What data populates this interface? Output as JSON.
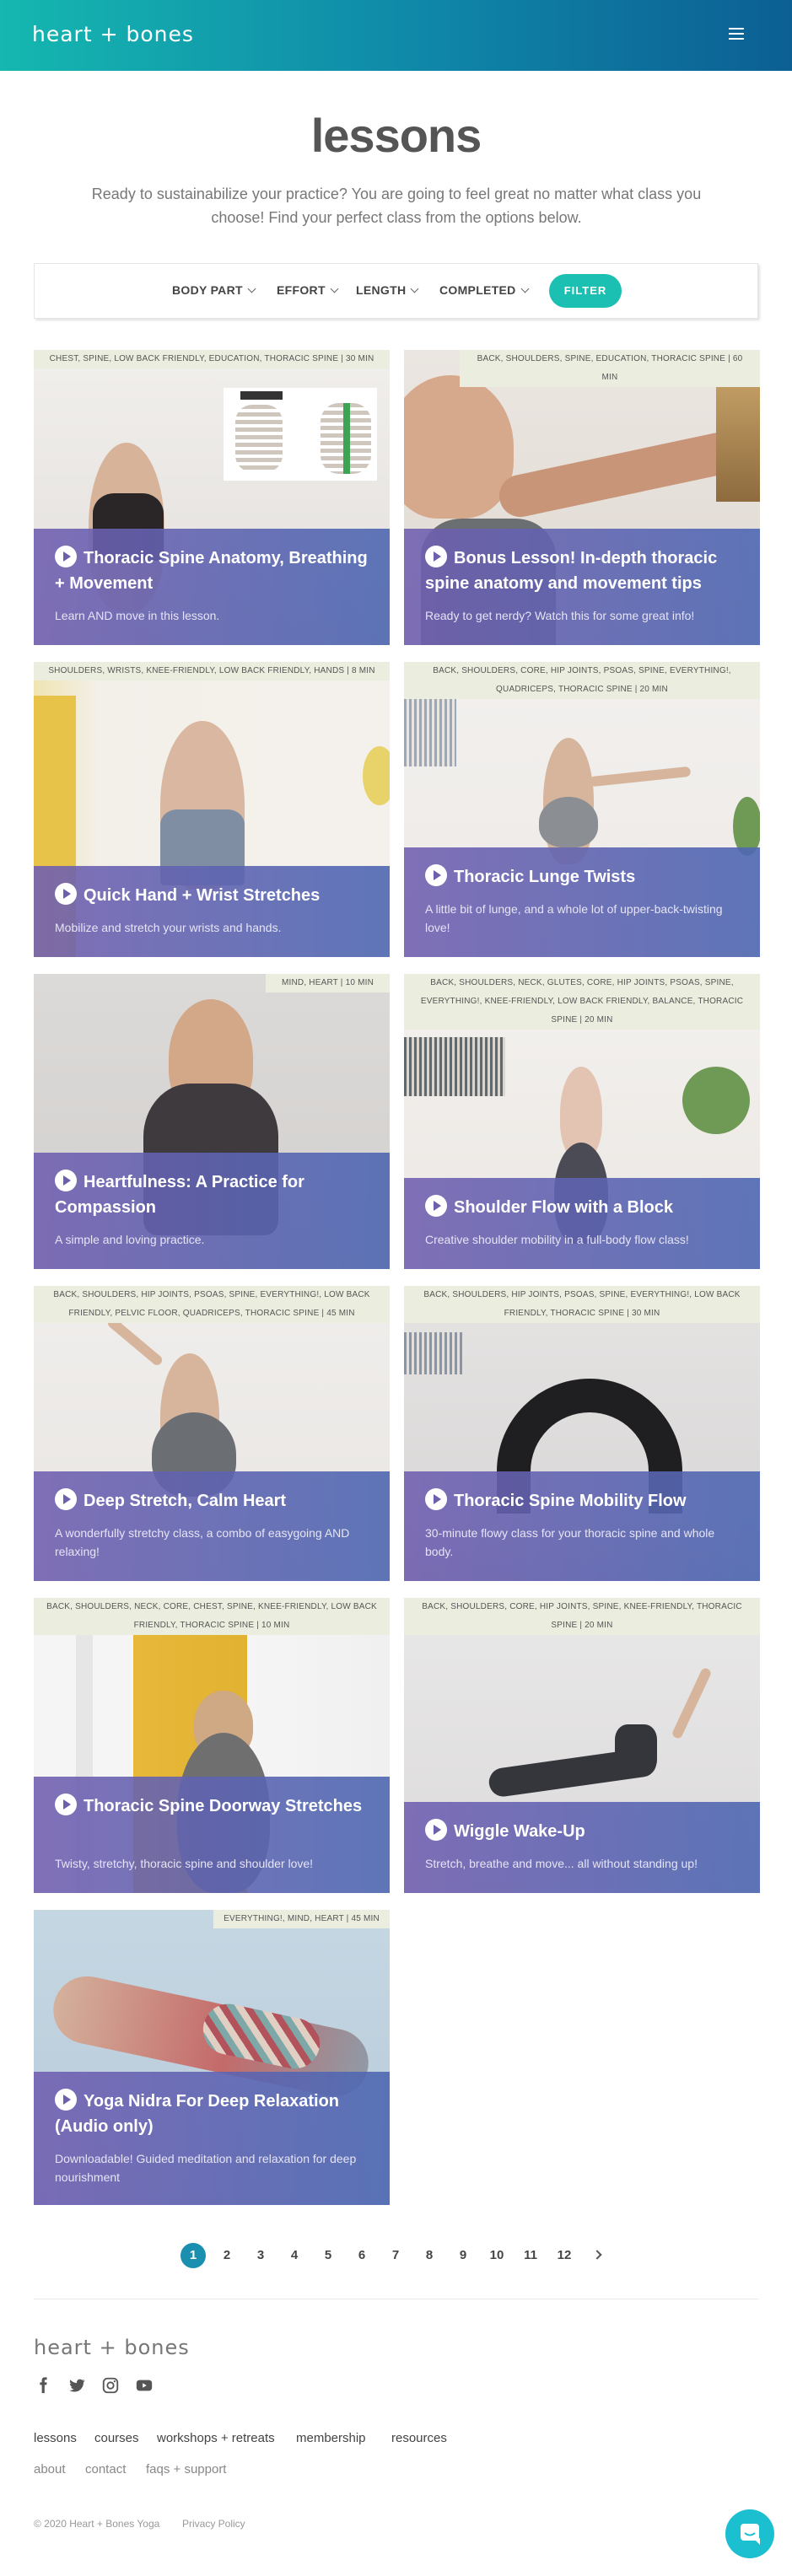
{
  "header": {
    "logo": "heart + bones",
    "menu_icon": "hamburger-menu-icon"
  },
  "hero": {
    "title": "lessons",
    "intro": "Ready to sustainabilize your practice? You are going to feel great no matter what class you choose! Find your perfect class from the options below."
  },
  "filters": {
    "items": [
      "BODY PART",
      "EFFORT",
      "LENGTH",
      "COMPLETED"
    ],
    "button": "FILTER"
  },
  "lessons": [
    {
      "tags": "CHEST, SPINE, LOW BACK FRIENDLY, EDUCATION, THORACIC SPINE | 30 MIN",
      "title": "Thoracic Spine Anatomy, Breathing + Movement",
      "description": "Learn AND move in this lesson."
    },
    {
      "tags": "BACK, SHOULDERS, SPINE, EDUCATION, THORACIC SPINE | 60 MIN",
      "title": "Bonus Lesson! In-depth thoracic spine anatomy and movement tips",
      "description": "Ready to get nerdy? Watch this for some great info!"
    },
    {
      "tags": "SHOULDERS, WRISTS, KNEE-FRIENDLY, LOW BACK FRIENDLY, HANDS | 8 MIN",
      "title": "Quick Hand + Wrist Stretches",
      "description": "Mobilize and stretch your wrists and hands."
    },
    {
      "tags": "BACK, SHOULDERS, CORE, HIP JOINTS, PSOAS, SPINE, EVERYTHING!, QUADRICEPS, THORACIC SPINE | 20 MIN",
      "title": "Thoracic Lunge Twists",
      "description": "A little bit of lunge, and a whole lot of upper-back-twisting love!"
    },
    {
      "tags": "MIND, HEART | 10 MIN",
      "title": "Heartfulness: A Practice for Compassion",
      "description": "A simple and loving practice."
    },
    {
      "tags": "BACK, SHOULDERS, NECK, GLUTES, CORE, HIP JOINTS, PSOAS, SPINE, EVERYTHING!, KNEE-FRIENDLY, LOW BACK FRIENDLY, BALANCE, THORACIC SPINE | 20 MIN",
      "title": "Shoulder Flow with a Block",
      "description": "Creative shoulder mobility in a full-body flow class!"
    },
    {
      "tags": "BACK, SHOULDERS, HIP JOINTS, PSOAS, SPINE, EVERYTHING!, LOW BACK FRIENDLY, PELVIC FLOOR, QUADRICEPS, THORACIC SPINE | 45 MIN",
      "title": "Deep Stretch, Calm Heart",
      "description": "A wonderfully stretchy class, a combo of easygoing AND relaxing!"
    },
    {
      "tags": "BACK, SHOULDERS, HIP JOINTS, PSOAS, SPINE, EVERYTHING!, LOW BACK FRIENDLY, THORACIC SPINE | 30 MIN",
      "title": "Thoracic Spine Mobility Flow",
      "description": "30-minute flowy class for your thoracic spine and whole body."
    },
    {
      "tags": "BACK, SHOULDERS, NECK, CORE, CHEST, SPINE, KNEE-FRIENDLY, LOW BACK FRIENDLY, THORACIC SPINE | 10 MIN",
      "title": "Thoracic Spine Doorway Stretches",
      "description": "Twisty, stretchy, thoracic spine and shoulder love!"
    },
    {
      "tags": "BACK, SHOULDERS, CORE, HIP JOINTS, SPINE, KNEE-FRIENDLY, THORACIC SPINE | 20 MIN",
      "title": "Wiggle Wake-Up",
      "description": "Stretch, breathe and move... all without standing up!"
    },
    {
      "tags": "EVERYTHING!, MIND, HEART | 45 MIN",
      "title": "Yoga Nidra For Deep Relaxation (Audio only)",
      "description": "Downloadable! Guided meditation and relaxation for deep nourishment"
    }
  ],
  "pagination": {
    "pages": [
      "1",
      "2",
      "3",
      "4",
      "5",
      "6",
      "7",
      "8",
      "9",
      "10",
      "11",
      "12"
    ],
    "current": "1",
    "next_icon": "chevron-right-icon"
  },
  "footer": {
    "logo": "heart + bones",
    "social_icons": [
      "facebook-icon",
      "twitter-icon",
      "instagram-icon",
      "youtube-icon"
    ],
    "primary_links": [
      "lessons",
      "courses",
      "workshops + retreats",
      "membership",
      "resources"
    ],
    "secondary_links": [
      "about",
      "contact",
      "faqs + support"
    ],
    "copyright": "© 2020 Heart + Bones Yoga",
    "privacy": "Privacy Policy",
    "chat_icon": "chat-bubble-icon"
  },
  "colors": {
    "accent": "#1cc0b2",
    "header_start": "#15b7b0",
    "header_end": "#0c5f93",
    "overlay": "#6d5fb0",
    "tag_bg": "#ebeedf"
  }
}
